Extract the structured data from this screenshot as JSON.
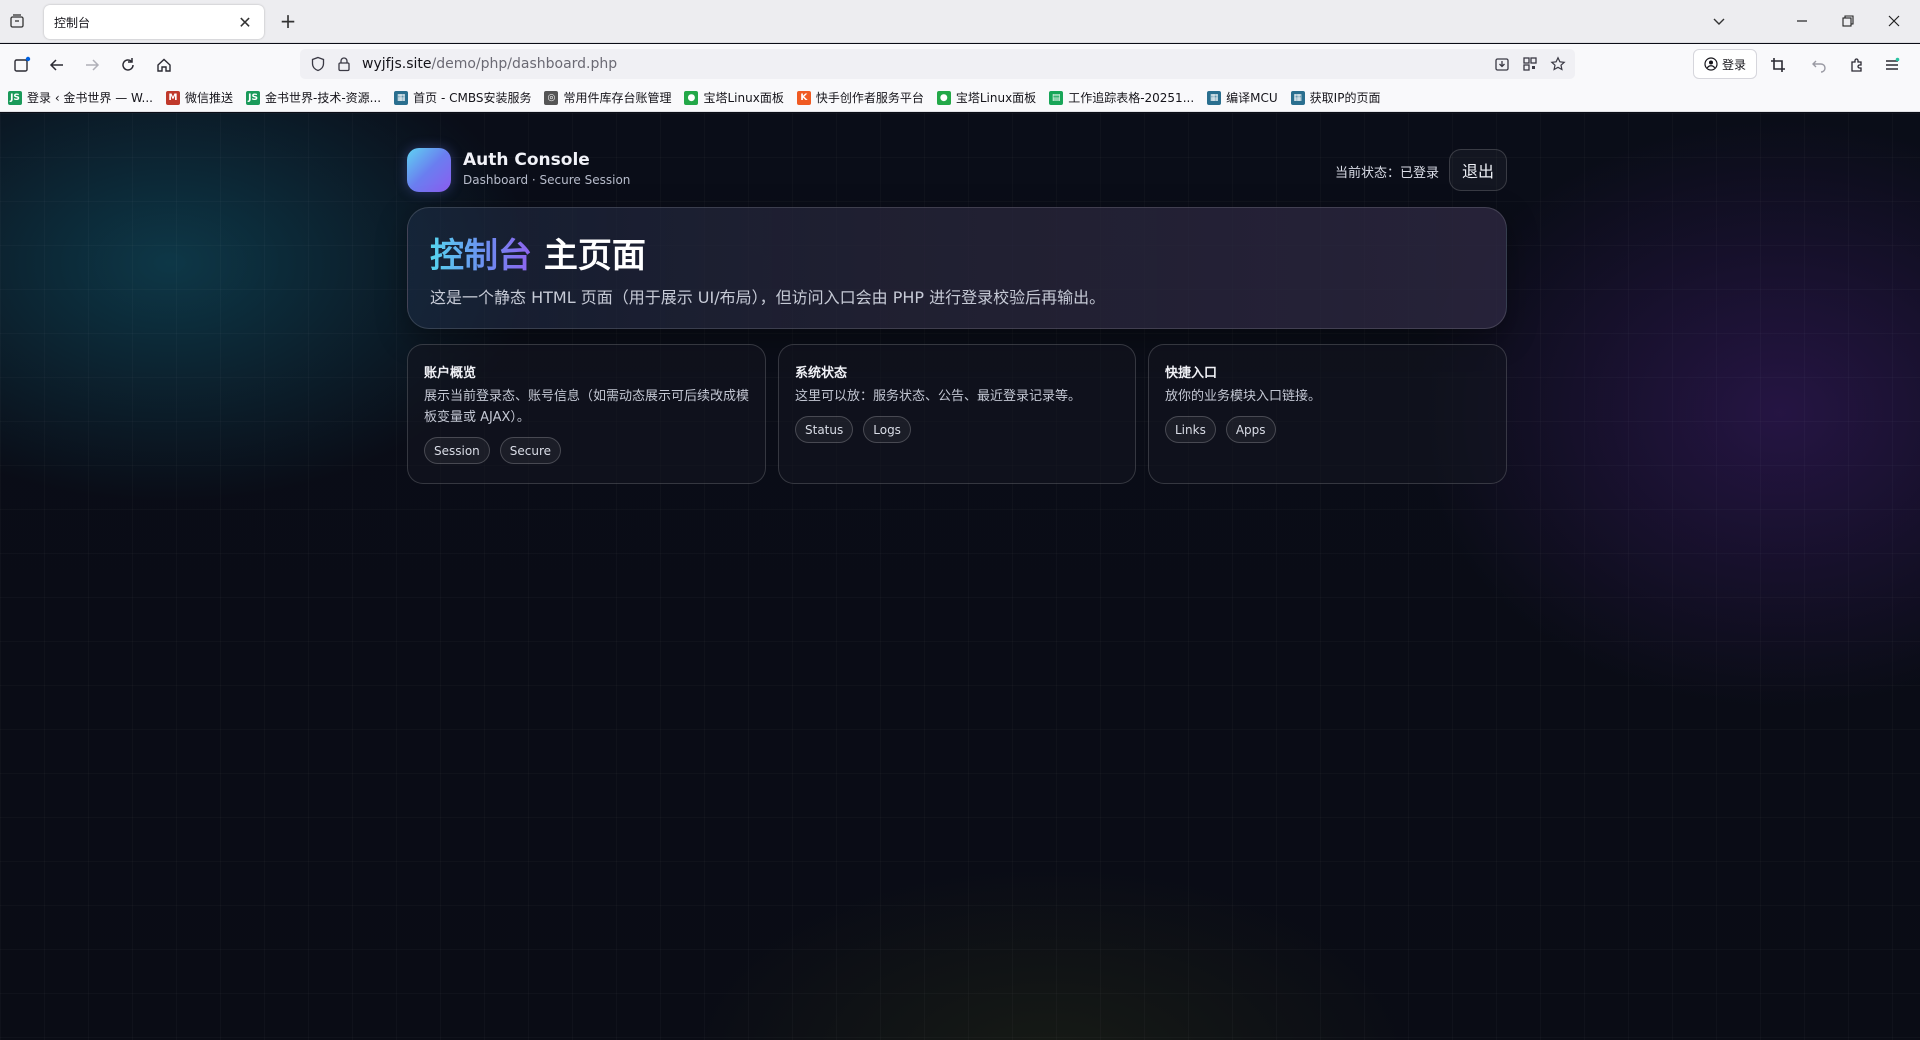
{
  "browser": {
    "tab_title": "控制台",
    "tab_close": "✕",
    "new_tab": "+",
    "url_host": "wyjfjs.site",
    "url_path": "/demo/php/dashboard.php",
    "account_label": "登录",
    "window_controls": [
      "minimize",
      "restore",
      "close"
    ],
    "bookmarks": [
      {
        "label": "登录 ‹ 金书世界 — W...",
        "icon": "JS",
        "color": "#1a9a5a"
      },
      {
        "label": "微信推送",
        "icon": "M",
        "color": "#c0392b"
      },
      {
        "label": "金书世界-技术-资源...",
        "icon": "JS",
        "color": "#1a9a5a"
      },
      {
        "label": "首页 - CMBS安装服务",
        "icon": "▦",
        "color": "#2a6f8f"
      },
      {
        "label": "常用件库存台账管理",
        "icon": "◎",
        "color": "#555555"
      },
      {
        "label": "宝塔Linux面板",
        "icon": "●",
        "color": "#23a848"
      },
      {
        "label": "快手创作者服务平台",
        "icon": "K",
        "color": "#f05a22"
      },
      {
        "label": "宝塔Linux面板",
        "icon": "●",
        "color": "#23a848"
      },
      {
        "label": "工作追踪表格-20251...",
        "icon": "▤",
        "color": "#18a558"
      },
      {
        "label": "编译MCU",
        "icon": "▦",
        "color": "#2a6f8f"
      },
      {
        "label": "获取IP的页面",
        "icon": "▦",
        "color": "#2a6f8f"
      }
    ]
  },
  "header": {
    "brand_name": "Auth Console",
    "brand_sub": "Dashboard · Secure Session",
    "status": "当前状态：已登录",
    "logout_label": "退出"
  },
  "hero": {
    "title_highlight": "控制台",
    "title_rest": " 主页面",
    "description": "这是一个静态 HTML 页面（用于展示 UI/布局），但访问入口会由 PHP 进行登录校验后再输出。"
  },
  "cards": [
    {
      "title": "账户概览",
      "desc": "展示当前登录态、账号信息（如需动态展示可后续改成模板变量或 AJAX）。",
      "tags": [
        "Session",
        "Secure"
      ]
    },
    {
      "title": "系统状态",
      "desc": "这里可以放：服务状态、公告、最近登录记录等。",
      "tags": [
        "Status",
        "Logs"
      ]
    },
    {
      "title": "快捷入口",
      "desc": "放你的业务模块入口链接。",
      "tags": [
        "Links",
        "Apps"
      ]
    }
  ],
  "colors": {
    "accent_start": "#56d6ef",
    "accent_end": "#8f63ee",
    "page_bg": "#0b0d16"
  }
}
